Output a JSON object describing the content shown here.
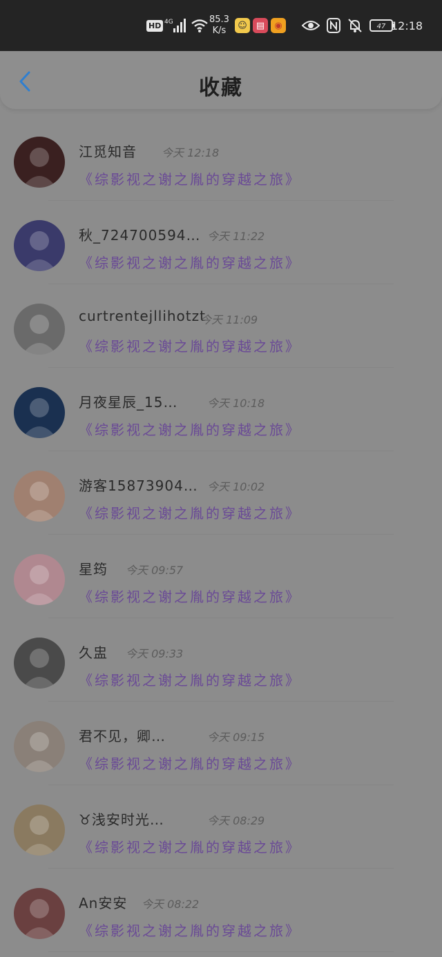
{
  "status_bar": {
    "hd_label": "HD",
    "net_label": "4G",
    "speed_value": "85.3",
    "speed_unit": "K/s",
    "battery": "47",
    "time": "12:18",
    "icons": [
      "hd-icon",
      "signal-icon",
      "wifi-icon",
      "wechat-app-icon",
      "book-app-icon",
      "weibo-app-icon",
      "eye-icon",
      "nfc-icon",
      "mute-icon",
      "battery-icon"
    ]
  },
  "header": {
    "title": "收藏",
    "back_icon": "chevron-left-icon",
    "accent": "#2f7fd0"
  },
  "items": [
    {
      "name": "江觅知音",
      "time": "今天  12:18",
      "book": "《综影视之谢之胤的穿越之旅》",
      "avatar_color": "#3a2020"
    },
    {
      "name": "秋_724700594…",
      "time": "今天  11:22",
      "book": "《综影视之谢之胤的穿越之旅》",
      "avatar_color": "#3a3a6a"
    },
    {
      "name": "curtrentejllihotzt",
      "time": "今天  11:09",
      "book": "《综影视之谢之胤的穿越之旅》",
      "avatar_color": "#6a6a6a"
    },
    {
      "name": "月夜星辰_15…",
      "time": "今天  10:18",
      "book": "《综影视之谢之胤的穿越之旅》",
      "avatar_color": "#1a3050"
    },
    {
      "name": "游客15873904…",
      "time": "今天  10:02",
      "book": "《综影视之谢之胤的穿越之旅》",
      "avatar_color": "#a08070"
    },
    {
      "name": "星筠",
      "time": "今天  09:57",
      "book": "《综影视之谢之胤的穿越之旅》",
      "avatar_color": "#b08890"
    },
    {
      "name": "久盅",
      "time": "今天  09:33",
      "book": "《综影视之谢之胤的穿越之旅》",
      "avatar_color": "#4a4a4a"
    },
    {
      "name": "君不见，卿…",
      "time": "今天  09:15",
      "book": "《综影视之谢之胤的穿越之旅》",
      "avatar_color": "#8a8078"
    },
    {
      "name": "♉浅安时光…",
      "time": "今天  08:29",
      "book": "《综影视之谢之胤的穿越之旅》",
      "avatar_color": "#8a7a60"
    },
    {
      "name": "An安安",
      "time": "今天  08:22",
      "book": "《综影视之谢之胤的穿越之旅》",
      "avatar_color": "#6a4040"
    }
  ]
}
